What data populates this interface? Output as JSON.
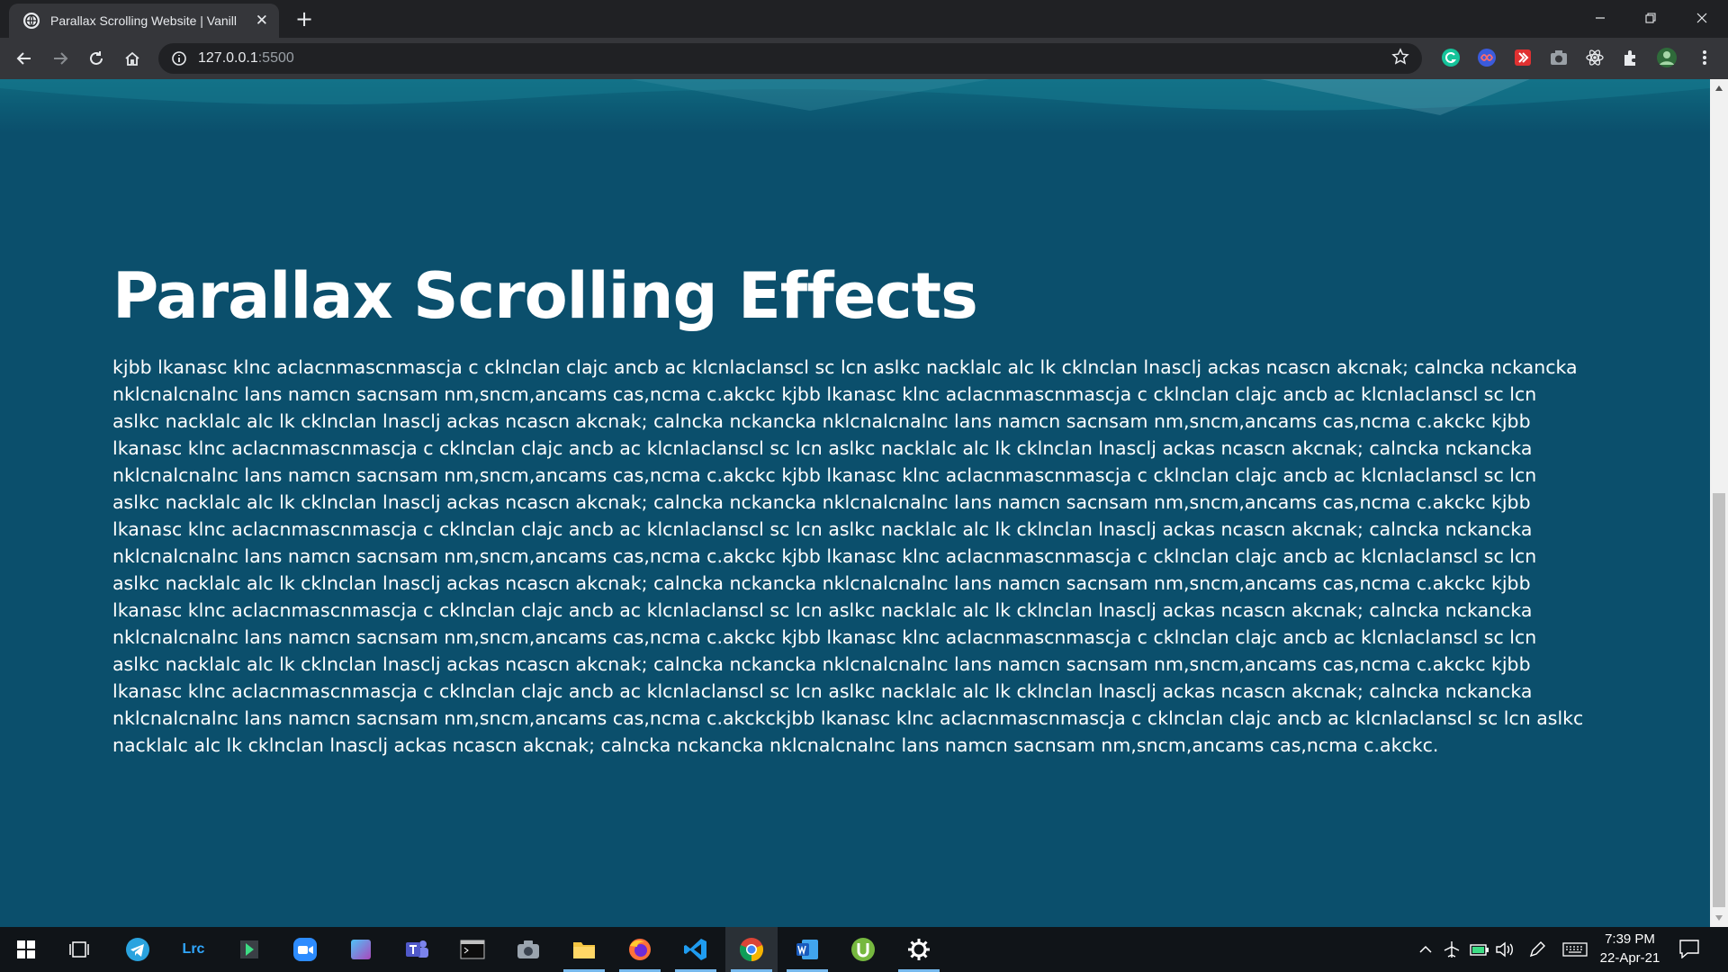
{
  "browser": {
    "tab_title": "Parallax Scrolling Website | Vanill",
    "url_host": "127.0.0.1",
    "url_port": ":5500",
    "new_tab_label": "+",
    "tab_close_label": "✕"
  },
  "page": {
    "title": "Parallax Scrolling Effects",
    "paragraph": "kjbb lkanasc klnc aclacnmascnmascja c cklnclan clajc ancb ac klcnlaclanscl sc lcn aslkc nacklalc alc lk cklnclan lnasclj ackas ncascn akcnak; calncka nckancka nklcnalcnalnc lans namcn sacnsam nm,sncm,ancams cas,ncma c.akckc kjbb lkanasc klnc aclacnmascnmascja c cklnclan clajc ancb ac klcnlaclanscl sc lcn aslkc nacklalc alc lk cklnclan lnasclj ackas ncascn akcnak; calncka nckancka nklcnalcnalnc lans namcn sacnsam nm,sncm,ancams cas,ncma c.akckc kjbb lkanasc klnc aclacnmascnmascja c cklnclan clajc ancb ac klcnlaclanscl sc lcn aslkc nacklalc alc lk cklnclan lnasclj ackas ncascn akcnak; calncka nckancka nklcnalcnalnc lans namcn sacnsam nm,sncm,ancams cas,ncma c.akckc kjbb lkanasc klnc aclacnmascnmascja c cklnclan clajc ancb ac klcnlaclanscl sc lcn aslkc nacklalc alc lk cklnclan lnasclj ackas ncascn akcnak; calncka nckancka nklcnalcnalnc lans namcn sacnsam nm,sncm,ancams cas,ncma c.akckc kjbb lkanasc klnc aclacnmascnmascja c cklnclan clajc ancb ac klcnlaclanscl sc lcn aslkc nacklalc alc lk cklnclan lnasclj ackas ncascn akcnak; calncka nckancka nklcnalcnalnc lans namcn sacnsam nm,sncm,ancams cas,ncma c.akckc kjbb lkanasc klnc aclacnmascnmascja c cklnclan clajc ancb ac klcnlaclanscl sc lcn aslkc nacklalc alc lk cklnclan lnasclj ackas ncascn akcnak; calncka nckancka nklcnalcnalnc lans namcn sacnsam nm,sncm,ancams cas,ncma c.akckc kjbb lkanasc klnc aclacnmascnmascja c cklnclan clajc ancb ac klcnlaclanscl sc lcn aslkc nacklalc alc lk cklnclan lnasclj ackas ncascn akcnak; calncka nckancka nklcnalcnalnc lans namcn sacnsam nm,sncm,ancams cas,ncma c.akckc kjbb lkanasc klnc aclacnmascnmascja c cklnclan clajc ancb ac klcnlaclanscl sc lcn aslkc nacklalc alc lk cklnclan lnasclj ackas ncascn akcnak; calncka nckancka nklcnalcnalnc lans namcn sacnsam nm,sncm,ancams cas,ncma c.akckc kjbb lkanasc klnc aclacnmascnmascja c cklnclan clajc ancb ac klcnlaclanscl sc lcn aslkc nacklalc alc lk cklnclan lnasclj ackas ncascn akcnak; calncka nckancka nklcnalcnalnc lans namcn sacnsam nm,sncm,ancams cas,ncma c.akckckjbb lkanasc klnc aclacnmascnmascja c cklnclan clajc ancb ac klcnlaclanscl sc lcn aslkc nacklalc alc lk cklnclan lnasclj ackas ncascn akcnak; calncka nckancka nklcnalcnalnc lans namcn sacnsam nm,sncm,ancams cas,ncma c.akckc."
  },
  "taskbar": {
    "time": "7:39 PM",
    "date": "22-Apr-21",
    "lightroom_label": "Lrc",
    "apps": [
      "start-icon",
      "task-view-icon",
      "telegram-icon",
      "lightroom-icon",
      "android-studio-icon",
      "zoom-icon",
      "app-icon",
      "teams-icon",
      "terminal-icon",
      "camera-icon",
      "file-explorer-icon",
      "firefox-icon",
      "vscode-icon",
      "chrome-icon",
      "word-icon",
      "utorrent-icon",
      "settings-icon"
    ]
  },
  "colors": {
    "page_bg": "#0b4f6c",
    "chrome_dark": "#202124",
    "toolbar": "#35363a",
    "taskbar": "#101418"
  }
}
